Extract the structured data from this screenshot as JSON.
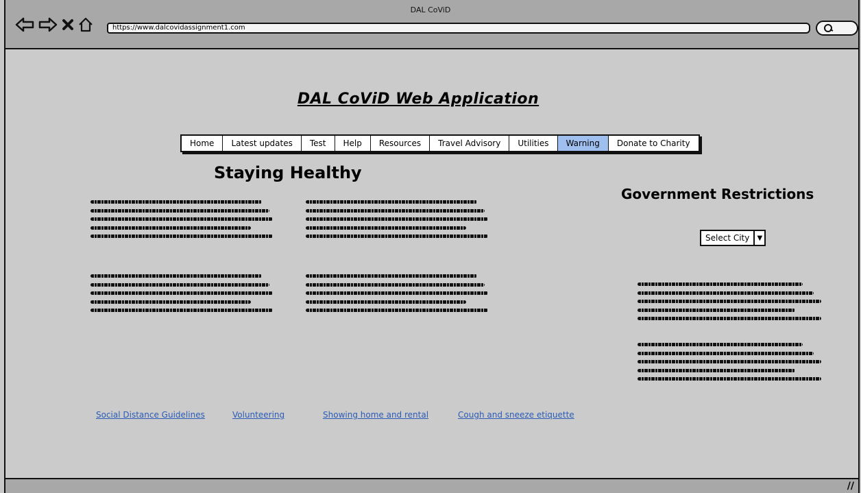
{
  "window": {
    "title": "DAL CoViD"
  },
  "browser": {
    "url": "https://www.dalcovidassignment1.com",
    "icons": [
      "back-arrow-icon",
      "forward-arrow-icon",
      "close-icon",
      "home-icon",
      "search-icon"
    ]
  },
  "page": {
    "app_title": "DAL CoViD Web Application",
    "menu": [
      {
        "label": "Home",
        "active": false
      },
      {
        "label": "Latest updates",
        "active": false
      },
      {
        "label": "Test",
        "active": false
      },
      {
        "label": "Help",
        "active": false
      },
      {
        "label": "Resources",
        "active": false
      },
      {
        "label": "Travel Advisory",
        "active": false
      },
      {
        "label": "Utilities",
        "active": false
      },
      {
        "label": "Warning",
        "active": true
      },
      {
        "label": "Donate to Charity",
        "active": false
      }
    ],
    "staying_healthy": {
      "heading": "Staying Healthy"
    },
    "government": {
      "heading": "Government Restrictions",
      "select_value": "Select City"
    },
    "links": [
      "Social Distance Guidelines",
      "Volunteering",
      "Showing home and rental",
      "Cough and sneeze etiquette"
    ],
    "accent_color": "#9fbfef",
    "link_color": "#2a5bb7"
  }
}
